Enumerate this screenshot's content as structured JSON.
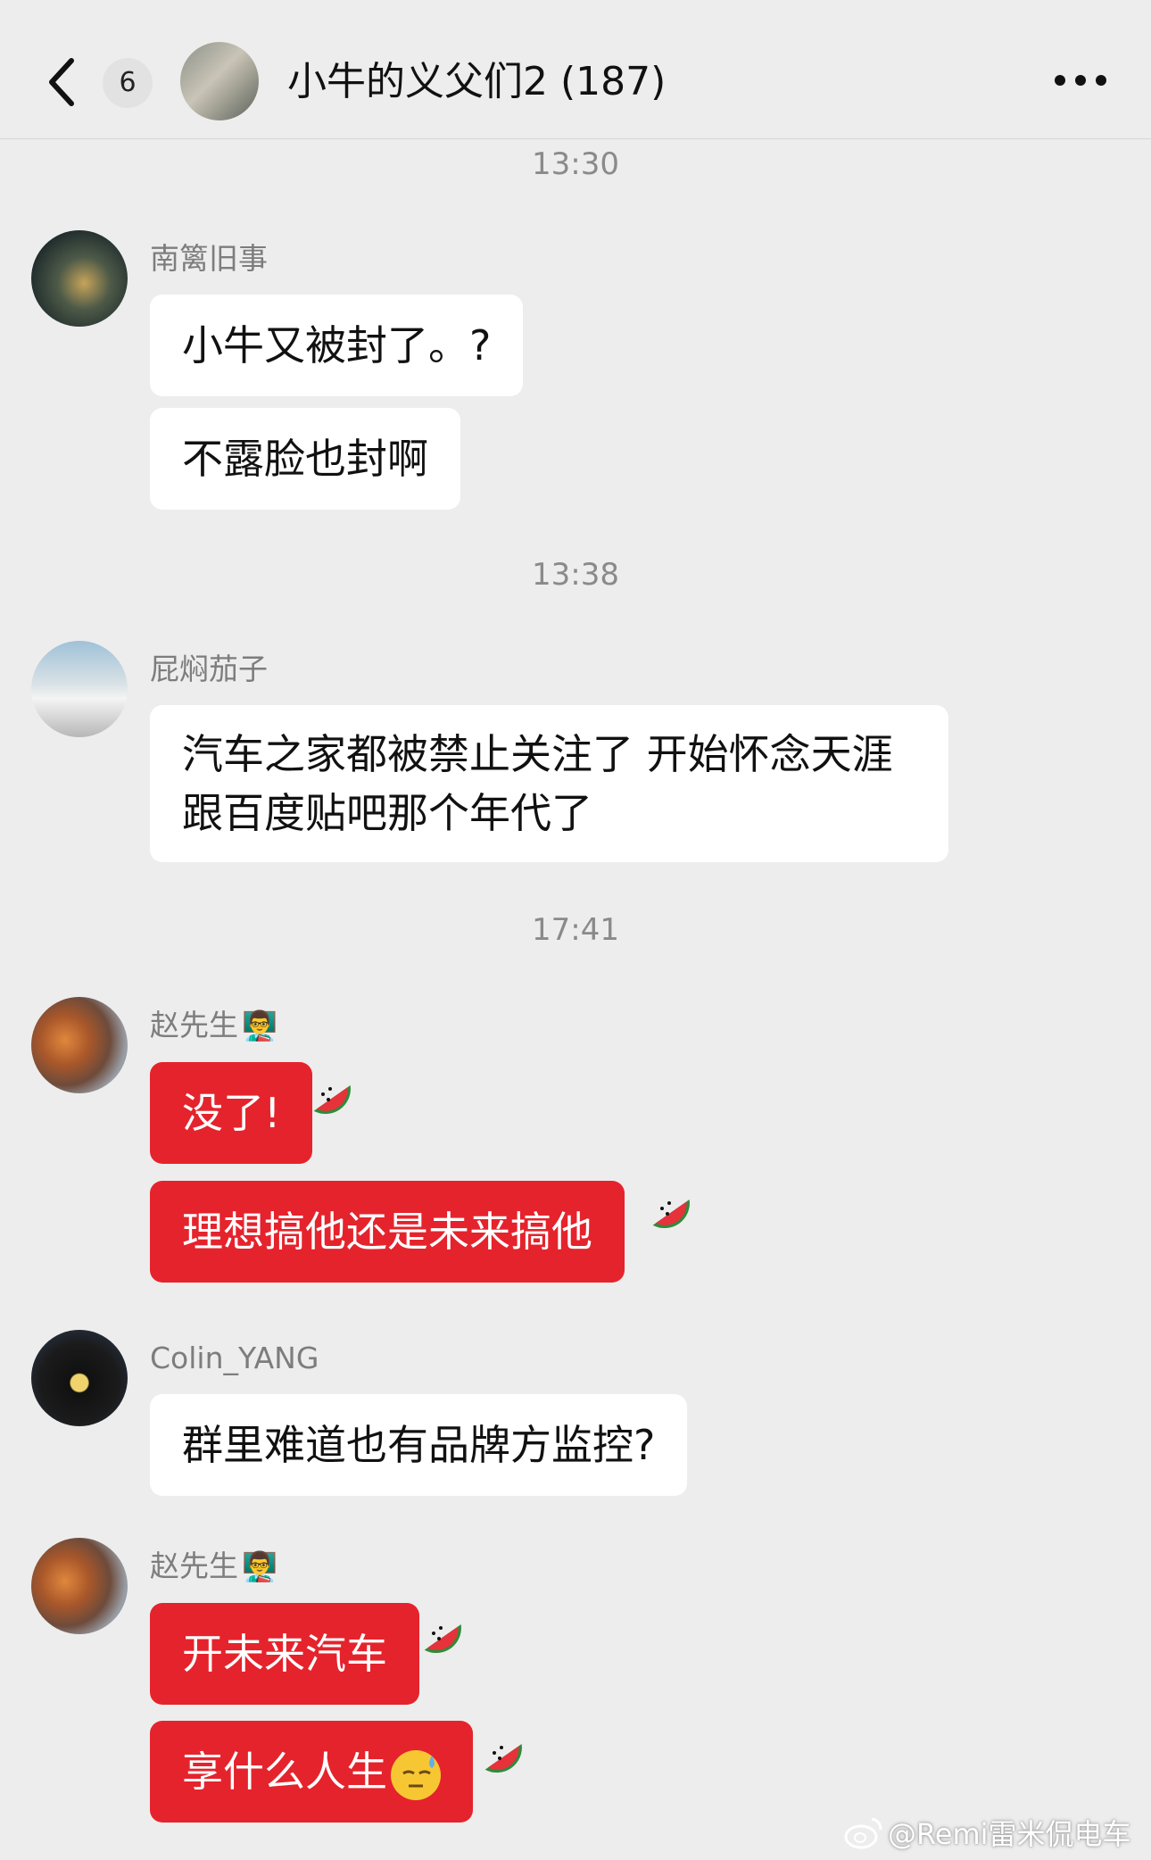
{
  "header": {
    "back_label": "<",
    "unread_count": "6",
    "title": "小牛的义父们2 (187)"
  },
  "timestamps": [
    "13:30",
    "13:38",
    "17:41"
  ],
  "messages": [
    {
      "sender": "南篱旧事",
      "bubbles": [
        "小牛又被封了。?",
        "不露脸也封啊"
      ]
    },
    {
      "sender": "屁焖茄子",
      "bubbles": [
        "汽车之家都被禁止关注了 开始怀念天涯跟百度贴吧那个年代了"
      ]
    },
    {
      "sender": "赵先生",
      "sender_emoji": "👨‍🏫",
      "bubbles": [
        "没了!",
        "理想搞他还是未来搞他"
      ]
    },
    {
      "sender": "Colin_YANG",
      "bubbles": [
        "群里难道也有品牌方监控?"
      ]
    },
    {
      "sender": "赵先生",
      "sender_emoji": "👨‍🏫",
      "bubbles": [
        "开未来汽车",
        "享什么人生"
      ]
    }
  ],
  "watermark": "@Remi雷米侃电车",
  "colors": {
    "background": "#ededed",
    "bubble_white": "#ffffff",
    "bubble_red": "#e5232c",
    "timestamp": "#8a8a8a",
    "sender_name": "#7d7d7d"
  },
  "icons": [
    "back-chevron-icon",
    "more-dots-icon",
    "watermelon-icon",
    "sweat-face-icon",
    "weibo-icon"
  ]
}
